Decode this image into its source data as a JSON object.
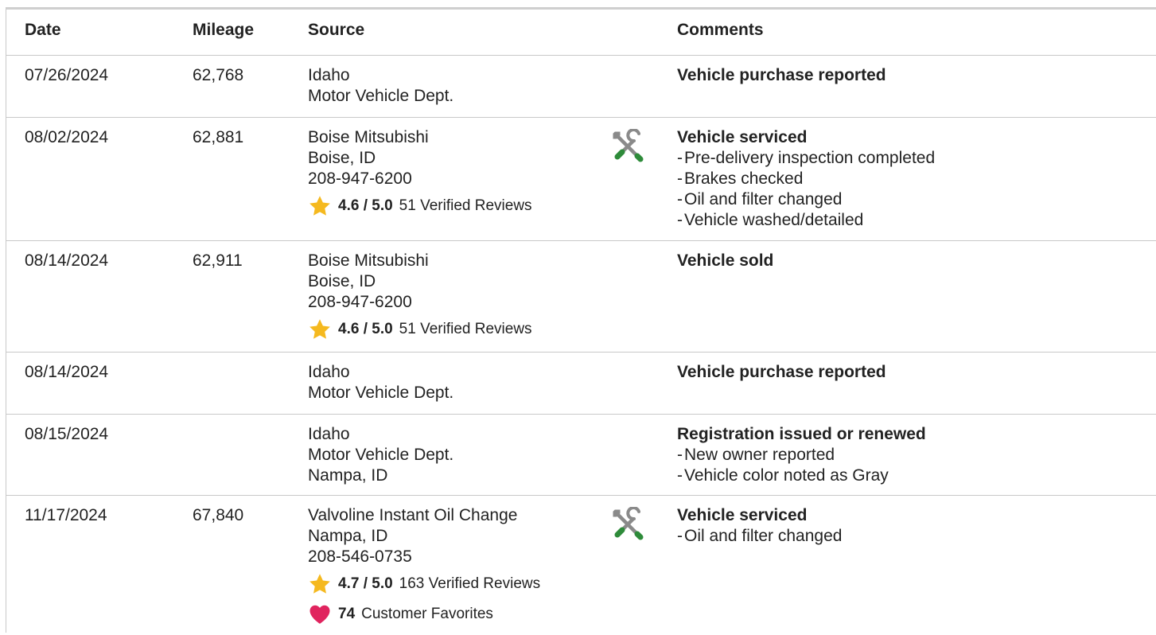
{
  "headers": {
    "date": "Date",
    "mileage": "Mileage",
    "source": "Source",
    "comments": "Comments"
  },
  "rows": [
    {
      "date": "07/26/2024",
      "mileage": "62,768",
      "source_lines": [
        "Idaho",
        "Motor Vehicle Dept."
      ],
      "comment_title": "Vehicle purchase reported",
      "comment_items": []
    },
    {
      "date": "08/02/2024",
      "mileage": "62,881",
      "source_lines": [
        "Boise Mitsubishi",
        "Boise, ID",
        "208-947-6200"
      ],
      "rating": {
        "score": "4.6 / 5.0",
        "reviews": "51 Verified Reviews"
      },
      "icon": "service-tools-icon",
      "comment_title": "Vehicle serviced",
      "comment_items": [
        "Pre-delivery inspection completed",
        "Brakes checked",
        "Oil and filter changed",
        "Vehicle washed/detailed"
      ]
    },
    {
      "date": "08/14/2024",
      "mileage": "62,911",
      "source_lines": [
        "Boise Mitsubishi",
        "Boise, ID",
        "208-947-6200"
      ],
      "rating": {
        "score": "4.6 / 5.0",
        "reviews": "51 Verified Reviews"
      },
      "comment_title": "Vehicle sold",
      "comment_items": []
    },
    {
      "date": "08/14/2024",
      "mileage": "",
      "source_lines": [
        "Idaho",
        "Motor Vehicle Dept."
      ],
      "comment_title": "Vehicle purchase reported",
      "comment_items": []
    },
    {
      "date": "08/15/2024",
      "mileage": "",
      "source_lines": [
        "Idaho",
        "Motor Vehicle Dept.",
        "Nampa, ID"
      ],
      "comment_title": "Registration issued or renewed",
      "comment_items": [
        "New owner reported",
        "Vehicle color noted as Gray"
      ]
    },
    {
      "date": "11/17/2024",
      "mileage": "67,840",
      "source_lines": [
        "Valvoline Instant Oil Change",
        "Nampa, ID",
        "208-546-0735"
      ],
      "rating": {
        "score": "4.7 / 5.0",
        "reviews": "163 Verified Reviews"
      },
      "favorites": {
        "count": "74",
        "label": "Customer Favorites"
      },
      "icon": "service-tools-icon",
      "comment_title": "Vehicle serviced",
      "comment_items": [
        "Oil and filter changed"
      ]
    }
  ],
  "icons": {
    "star": "star-icon",
    "heart": "heart-icon",
    "service": "service-tools-icon"
  },
  "colors": {
    "star": "#f5b91f",
    "heart": "#e0245e",
    "wrench_handle": "#2e8b3a",
    "tool_gray": "#8a8a8a",
    "divider": "#c8c8c8"
  }
}
